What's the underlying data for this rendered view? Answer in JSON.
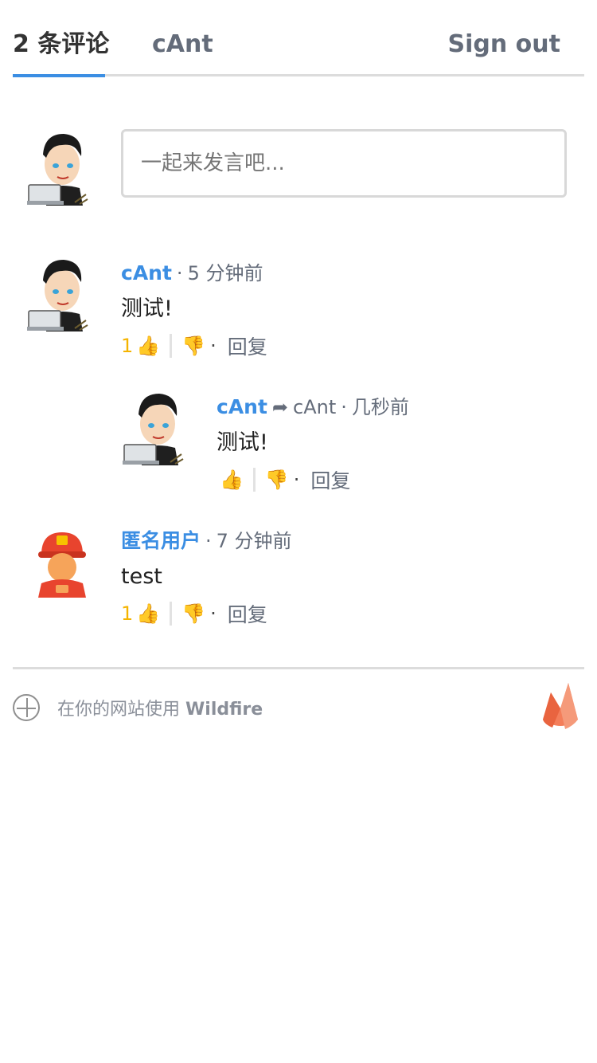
{
  "header": {
    "count_tab": "2 条评论",
    "user_tab": "cAnt",
    "sign_out": "Sign out"
  },
  "composer": {
    "placeholder": "一起来发言吧..."
  },
  "comments": [
    {
      "author": "cAnt",
      "time": "5 分钟前",
      "text": "测试!",
      "likes": "1",
      "reply_label": "回复",
      "avatar": "man-with-laptop-avatar"
    },
    {
      "author": "cAnt",
      "reply_to": "cAnt",
      "time": "几秒前",
      "text": "测试!",
      "likes": "",
      "reply_label": "回复",
      "avatar": "man-with-laptop-avatar"
    },
    {
      "author": "匿名用户",
      "time": "7 分钟前",
      "text": "test",
      "likes": "1",
      "reply_label": "回复",
      "avatar": "firefighter-avatar"
    }
  ],
  "footer": {
    "powered_prefix": "在你的网站使用",
    "brand": "Wildfire",
    "logo": "wildfire-flame-logo"
  },
  "colors": {
    "accent": "#3b8ee3",
    "like": "#f5b400",
    "text_muted": "#646c7a",
    "logo": "#f26f4b"
  }
}
